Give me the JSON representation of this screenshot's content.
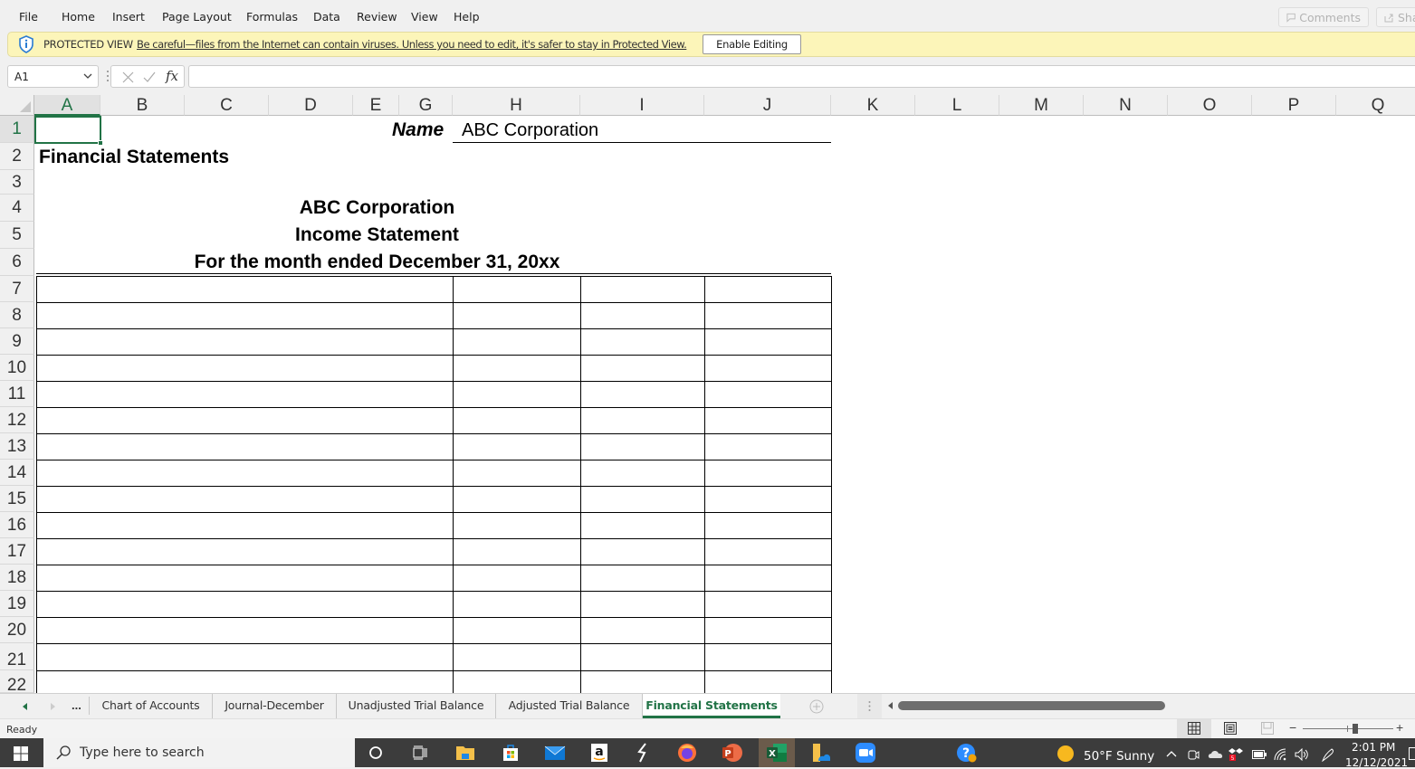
{
  "menu": {
    "items": [
      "File",
      "Home",
      "Insert",
      "Page Layout",
      "Formulas",
      "Data",
      "Review",
      "View",
      "Help"
    ],
    "comments_label": "Comments",
    "share_label": "Sha"
  },
  "protected_view": {
    "title": "PROTECTED VIEW",
    "message": "Be careful—files from the Internet can contain viruses. Unless you need to edit, it's safer to stay in Protected View.",
    "button_label": "Enable Editing"
  },
  "formula_bar": {
    "name_box": "A1",
    "fx_label": "fx",
    "formula_value": ""
  },
  "grid": {
    "columns": [
      "A",
      "B",
      "C",
      "D",
      "E",
      "G",
      "H",
      "I",
      "J",
      "K",
      "L",
      "M",
      "N",
      "O",
      "P",
      "Q"
    ],
    "rows": [
      "1",
      "2",
      "3",
      "4",
      "5",
      "6",
      "7",
      "8",
      "9",
      "10",
      "11",
      "12",
      "13",
      "14",
      "15",
      "16",
      "17",
      "18",
      "19",
      "20",
      "21",
      "22"
    ],
    "selected_cell": "A1",
    "cells": {
      "name_label": "Name",
      "name_value": "ABC Corporation",
      "sheet_heading": "Financial Statements",
      "company": "ABC Corporation",
      "statement": "Income Statement",
      "period": "For the month ended December 31, 20xx"
    }
  },
  "sheet_tabs": {
    "overflow_label": "...",
    "tabs": [
      "Chart of Accounts",
      "Journal-December",
      "Unadjusted Trial Balance",
      "Adjusted Trial Balance",
      "Financial Statements"
    ],
    "active": "Financial Statements"
  },
  "status_bar": {
    "status": "Ready",
    "zoom_minus": "−",
    "zoom_plus": "+"
  },
  "taskbar": {
    "search_placeholder": "Type here to search",
    "weather": "50°F  Sunny",
    "time": "2:01 PM",
    "date": "12/12/2021"
  },
  "colors": {
    "excel_green": "#217346",
    "protected_bar": "#fcf5b9",
    "taskbar": "#3c3c3c"
  }
}
